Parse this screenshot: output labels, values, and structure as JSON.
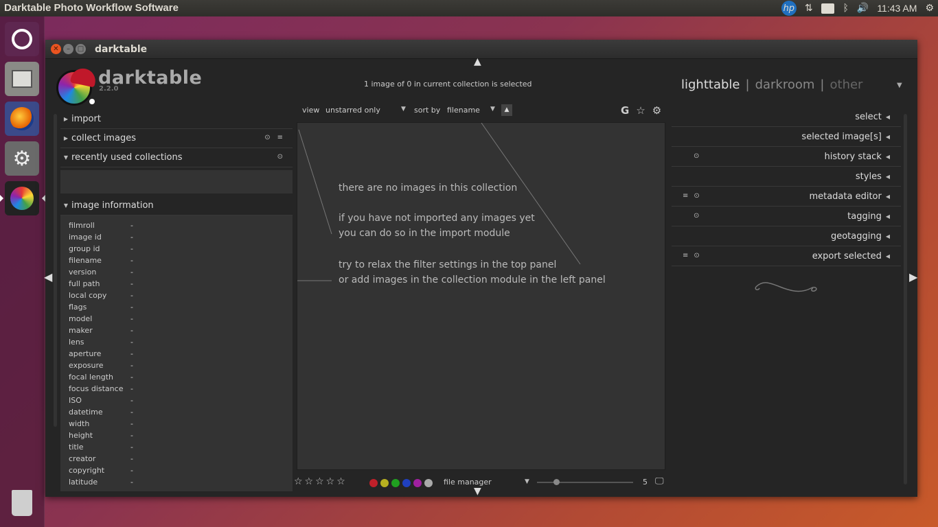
{
  "topbar": {
    "title": "Darktable Photo Workflow Software",
    "hp_label": "hp",
    "keyboard": "En",
    "time": "11:43 AM"
  },
  "launcher": {
    "items": [
      "ubuntu-dash",
      "files",
      "firefox",
      "system-settings",
      "darktable",
      "trash"
    ]
  },
  "window": {
    "title": "darktable"
  },
  "header": {
    "app_name": "darktable",
    "version": "2.2.0",
    "status": "1 image of 0 in current collection is selected",
    "views": {
      "current": "lighttable",
      "sep": "|",
      "darkroom": "darkroom",
      "other": "other"
    }
  },
  "left_panel": {
    "modules": [
      {
        "label": "import",
        "expanded": false
      },
      {
        "label": "collect images",
        "expanded": false
      },
      {
        "label": "recently used collections",
        "expanded": true
      },
      {
        "label": "image information",
        "expanded": true
      }
    ],
    "image_info": [
      {
        "key": "filmroll",
        "value": "-"
      },
      {
        "key": "image id",
        "value": "-"
      },
      {
        "key": "group id",
        "value": "-"
      },
      {
        "key": "filename",
        "value": "-"
      },
      {
        "key": "version",
        "value": "-"
      },
      {
        "key": "full path",
        "value": "-"
      },
      {
        "key": "local copy",
        "value": "-"
      },
      {
        "key": "flags",
        "value": "-"
      },
      {
        "key": "model",
        "value": "-"
      },
      {
        "key": "maker",
        "value": "-"
      },
      {
        "key": "lens",
        "value": "-"
      },
      {
        "key": "aperture",
        "value": "-"
      },
      {
        "key": "exposure",
        "value": "-"
      },
      {
        "key": "focal length",
        "value": "-"
      },
      {
        "key": "focus distance",
        "value": "-"
      },
      {
        "key": "ISO",
        "value": "-"
      },
      {
        "key": "datetime",
        "value": "-"
      },
      {
        "key": "width",
        "value": "-"
      },
      {
        "key": "height",
        "value": "-"
      },
      {
        "key": "title",
        "value": "-"
      },
      {
        "key": "creator",
        "value": "-"
      },
      {
        "key": "copyright",
        "value": "-"
      },
      {
        "key": "latitude",
        "value": "-"
      }
    ]
  },
  "filter": {
    "view_label": "view",
    "view_value": "unstarred only",
    "sort_label": "sort by",
    "sort_value": "filename"
  },
  "center": {
    "line1": "there are no images in this collection",
    "line2": "if you have not imported any images yet",
    "line3": "you can do so in the import module",
    "line4": "try to relax the filter settings in the top panel",
    "line5": "or add images in the collection module in the left panel"
  },
  "bottom": {
    "stars": "☆☆☆☆☆",
    "layout": "file manager",
    "zoom_value": "5",
    "color_labels": [
      "#c0202a",
      "#b8b020",
      "#20a020",
      "#2040c0",
      "#a020a0",
      "#aaaaaa"
    ]
  },
  "right_panel": {
    "modules": [
      {
        "label": "select"
      },
      {
        "label": "selected image[s]"
      },
      {
        "label": "history stack"
      },
      {
        "label": "styles"
      },
      {
        "label": "metadata editor"
      },
      {
        "label": "tagging"
      },
      {
        "label": "geotagging"
      },
      {
        "label": "export selected"
      }
    ]
  }
}
